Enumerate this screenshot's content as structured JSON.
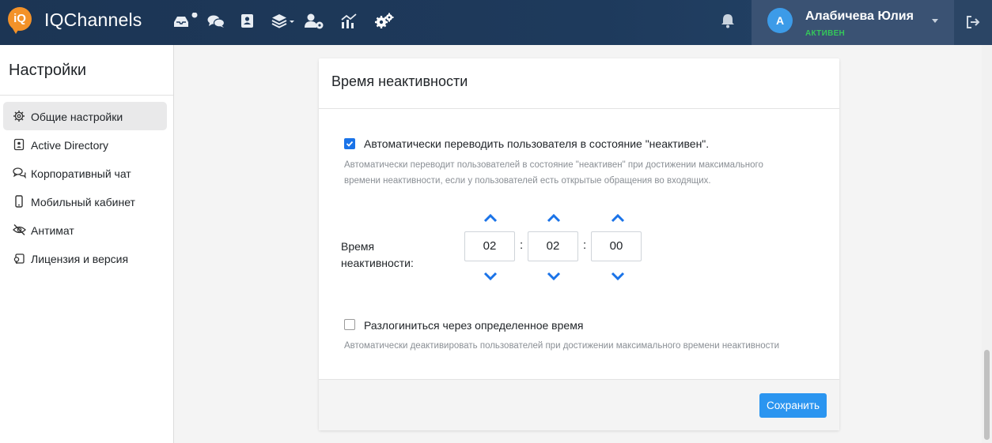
{
  "header": {
    "brand": "IQChannels",
    "logo_text": "iQ",
    "nav_icons": [
      "inbox-icon",
      "chats-icon",
      "contacts-icon",
      "layers-icon",
      "users-settings-icon",
      "analytics-icon",
      "settings-icon"
    ],
    "notification_icon": "bell-icon",
    "user": {
      "avatar_letter": "А",
      "name": "Алабичева Юлия",
      "status": "АКТИВЕН"
    },
    "logout_icon": "logout-icon"
  },
  "sidebar": {
    "title": "Настройки",
    "items": [
      {
        "label": "Общие настройки",
        "icon": "gear-icon",
        "active": true
      },
      {
        "label": "Active Directory",
        "icon": "id-card-icon",
        "active": false
      },
      {
        "label": "Корпоративный чат",
        "icon": "chat-bubbles-icon",
        "active": false
      },
      {
        "label": "Мобильный кабинет",
        "icon": "mobile-icon",
        "active": false
      },
      {
        "label": "Антимат",
        "icon": "eye-slash-icon",
        "active": false
      },
      {
        "label": "Лицензия и версия",
        "icon": "key-icon",
        "active": false
      }
    ]
  },
  "card": {
    "title": "Время неактивности",
    "auto_inactive": {
      "checked": true,
      "label": "Автоматически переводить пользователя в состояние \"неактивен\".",
      "hint_line1": "Автоматически переводит пользователей в состояние \"неактивен\" при достижении максимального",
      "hint_line2": "времени неактивности, если у пользователей есть открытые обращения во входящих."
    },
    "inactivity_time": {
      "label_line1": "Время",
      "label_line2": "неактивности:",
      "hours": "02",
      "minutes": "02",
      "seconds": "00",
      "separator": ":"
    },
    "auto_logout": {
      "checked": false,
      "label": "Разлогиниться через определенное время",
      "hint": "Автоматически деактивировать пользователей при достижении максимального времени неактивности"
    },
    "save_label": "Сохранить"
  },
  "colors": {
    "accent": "#2b95f0",
    "header_bg": "#1e3a5c",
    "status_active": "#35c75a",
    "logo": "#f39229"
  }
}
